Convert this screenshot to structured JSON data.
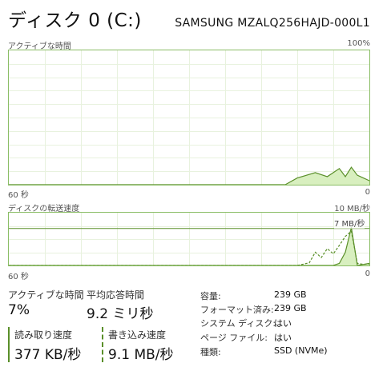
{
  "header": {
    "title": "ディスク 0 (C:)",
    "model": "SAMSUNG MZALQ256HAJD-000L1"
  },
  "active_time_graph": {
    "label": "アクティブな時間",
    "max_label": "100%",
    "time_label": "60 秒",
    "min_label": "0",
    "chart_data": {
      "type": "area",
      "ylim": [
        0,
        100
      ],
      "x_seconds_ago": [
        60,
        14,
        12,
        9,
        7,
        5,
        4,
        3,
        2,
        1,
        0
      ],
      "values": [
        0,
        0,
        5,
        9,
        6,
        12,
        6,
        13,
        7,
        5,
        3
      ]
    }
  },
  "transfer_graph": {
    "label": "ディスクの転送速度",
    "max_label": "10 MB/秒",
    "ref_label": "7 MB/秒",
    "time_label": "60 秒",
    "min_label": "0",
    "chart_data": {
      "type": "line",
      "ylim": [
        0,
        10
      ],
      "series": [
        {
          "name": "読み取り速度",
          "x_seconds_ago": [
            60,
            6,
            5,
            4,
            3,
            2,
            1,
            0
          ],
          "values": [
            0,
            0,
            0.4,
            2.5,
            7.2,
            0,
            0.2,
            0.4
          ]
        },
        {
          "name": "書き込み速度",
          "x_seconds_ago": [
            60,
            12,
            10,
            9,
            8,
            7,
            6,
            5,
            4,
            3,
            2,
            1,
            0
          ],
          "values": [
            0,
            0,
            0.5,
            2.5,
            1.5,
            3.2,
            2.2,
            3.8,
            5.5,
            6.5,
            0.4,
            0.2,
            0.3
          ]
        }
      ]
    }
  },
  "stats": {
    "active_time_label": "アクティブな時間",
    "active_time_value": "7%",
    "avg_response_label": "平均応答時間",
    "avg_response_value": "9.2 ミリ秒",
    "read_label": "読み取り速度",
    "read_value": "377 KB/秒",
    "write_label": "書き込み速度",
    "write_value": "9.1 MB/秒"
  },
  "info": {
    "capacity_key": "容量:",
    "capacity_val": "239 GB",
    "formatted_key": "フォーマット済み:",
    "formatted_val": "239 GB",
    "system_disk_key": "システム ディスク:",
    "system_disk_val": "はい",
    "page_file_key": "ページ ファイル:",
    "page_file_val": "はい",
    "type_key": "種類:",
    "type_val": "SSD (NVMe)"
  },
  "colors": {
    "accent": "#5a8f29",
    "fill": "#d8efbf",
    "border": "#8abd65",
    "grid": "#e8f2de"
  }
}
